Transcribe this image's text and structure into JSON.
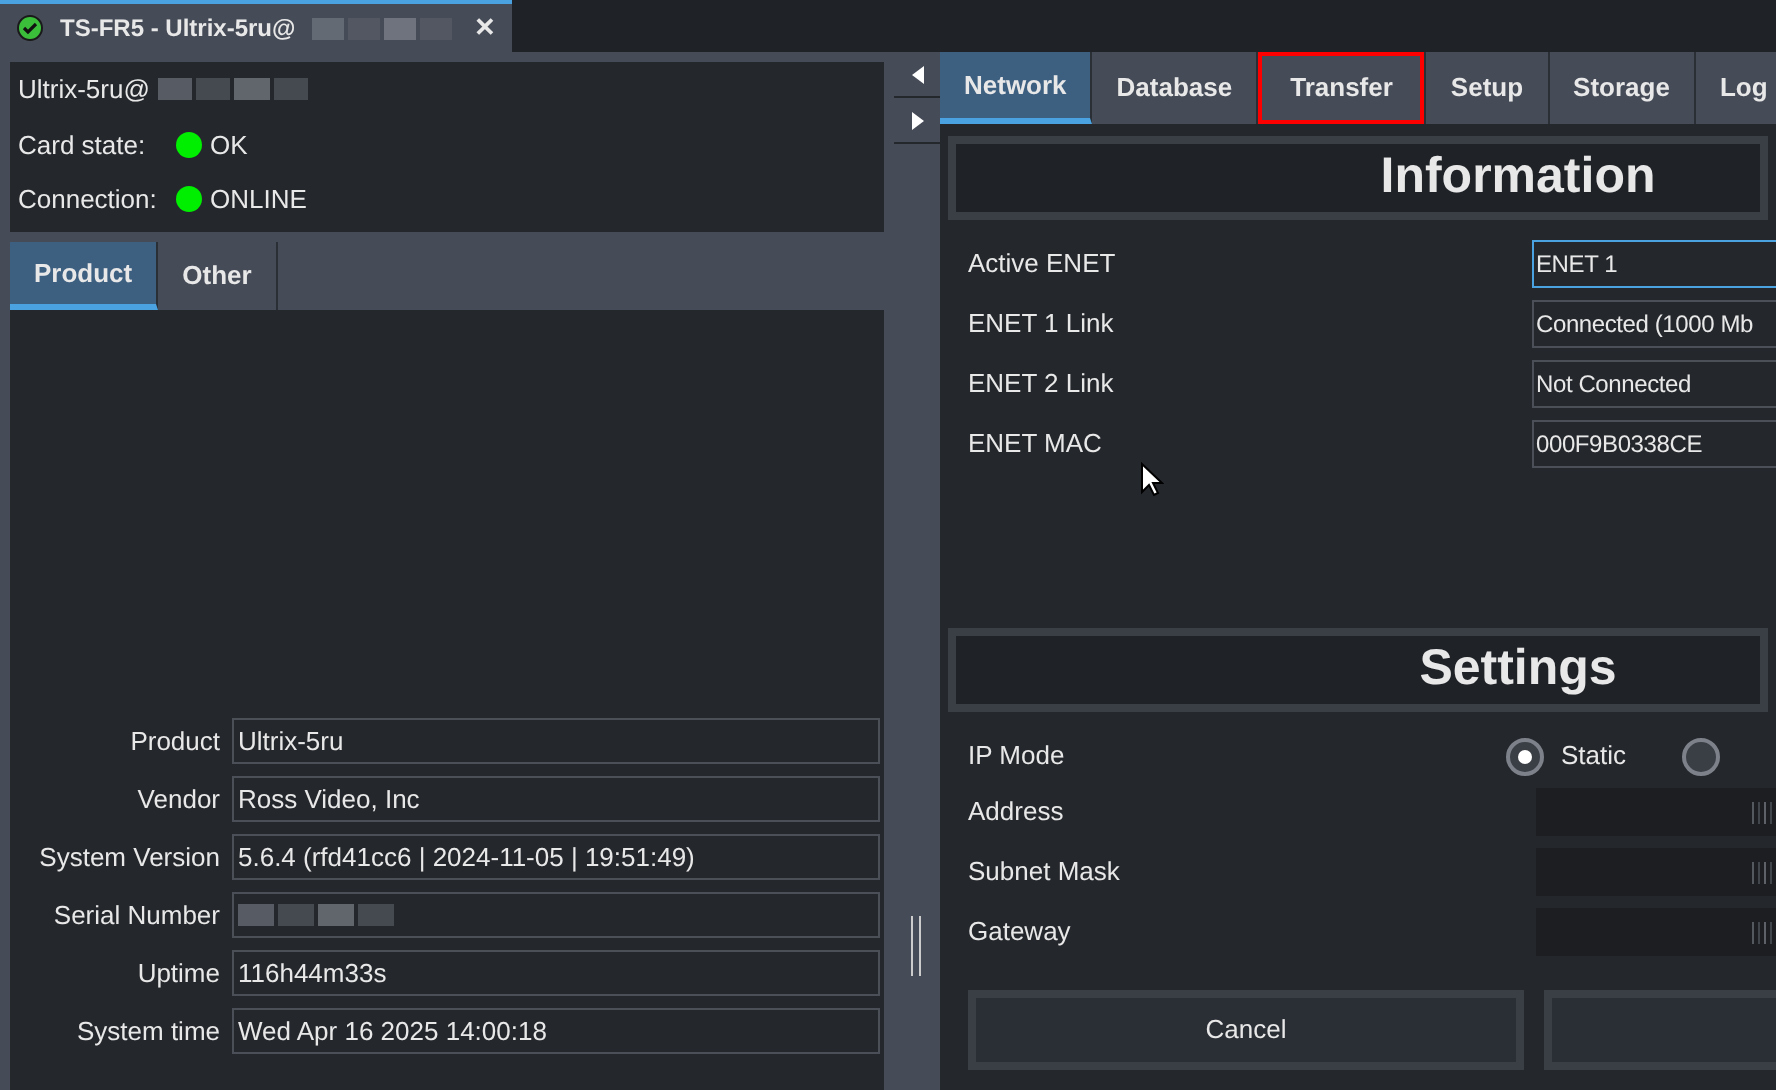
{
  "window_tab": {
    "title": "TS-FR5 - Ultrix-5ru@",
    "status_ok": true,
    "close": "✕"
  },
  "device": {
    "name": "Ultrix-5ru@",
    "rows": [
      {
        "label": "Card state:",
        "value": "OK",
        "color": "#00ee00"
      },
      {
        "label": "Connection:",
        "value": "ONLINE",
        "color": "#00ee00"
      }
    ]
  },
  "left_tabs": [
    {
      "label": "Product",
      "selected": true
    },
    {
      "label": "Other",
      "selected": false
    }
  ],
  "product": [
    {
      "label": "Product",
      "value": "Ultrix-5ru",
      "redacted": false
    },
    {
      "label": "Vendor",
      "value": "Ross Video, Inc",
      "redacted": false
    },
    {
      "label": "System Version",
      "value": "5.6.4 (rfd41cc6 | 2024-11-05 | 19:51:49)",
      "redacted": false
    },
    {
      "label": "Serial Number",
      "redacted": true
    },
    {
      "label": "Uptime",
      "value": "116h44m33s",
      "redacted": false
    },
    {
      "label": "System time",
      "value": "Wed Apr 16 2025  14:00:18",
      "redacted": false
    }
  ],
  "right_tabs": [
    {
      "label": "Network",
      "selected": true,
      "highlighted": false
    },
    {
      "label": "Database",
      "selected": false,
      "highlighted": false
    },
    {
      "label": "Transfer",
      "selected": false,
      "highlighted": true
    },
    {
      "label": "Setup",
      "selected": false,
      "highlighted": false
    },
    {
      "label": "Storage",
      "selected": false,
      "highlighted": false
    },
    {
      "label": "Log",
      "selected": false,
      "highlighted": false
    }
  ],
  "information": {
    "title": "Information",
    "rows": [
      {
        "label": "Active ENET",
        "value": "ENET 1",
        "focused": true
      },
      {
        "label": "ENET 1 Link",
        "value": "Connected (1000 Mb",
        "focused": false
      },
      {
        "label": "ENET 2 Link",
        "value": "Not Connected",
        "focused": false
      },
      {
        "label": "ENET MAC",
        "value": "000F9B0338CE",
        "focused": false
      }
    ]
  },
  "settings": {
    "title": "Settings",
    "ip_mode": {
      "label": "IP Mode",
      "options": [
        {
          "label": "Static",
          "selected": true
        },
        {
          "selected": false
        }
      ]
    },
    "rows": [
      {
        "label": "Address"
      },
      {
        "label": "Subnet Mask"
      },
      {
        "label": "Gateway"
      }
    ]
  },
  "buttons": [
    {
      "kind": "text",
      "label": "Cancel"
    },
    {
      "kind": "blank"
    }
  ]
}
